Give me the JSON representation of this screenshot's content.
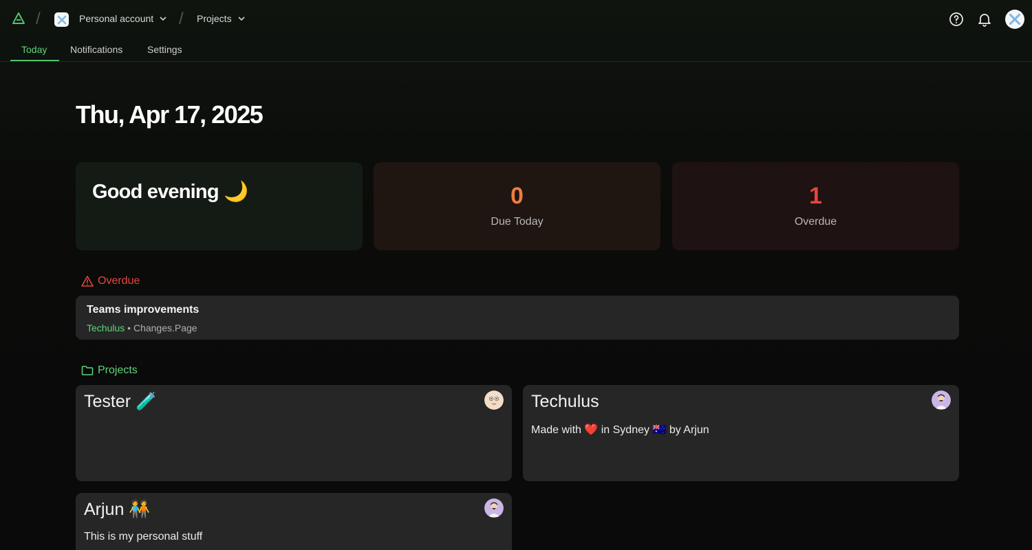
{
  "header": {
    "account": "Personal account",
    "projects_crumb": "Projects"
  },
  "tabs": [
    {
      "label": "Today",
      "active": true
    },
    {
      "label": "Notifications",
      "active": false
    },
    {
      "label": "Settings",
      "active": false
    }
  ],
  "date_title": "Thu, Apr 17, 2025",
  "greeting": "Good evening 🌙",
  "stats": [
    {
      "value": "0",
      "label": "Due Today",
      "color": "#ef7d3c"
    },
    {
      "value": "1",
      "label": "Overdue",
      "color": "#e4473f"
    }
  ],
  "overdue": {
    "heading": "Overdue",
    "items": [
      {
        "title": "Teams improvements",
        "project": "Techulus",
        "separator": " • ",
        "tag": "Changes.Page"
      }
    ]
  },
  "projects": {
    "heading": "Projects",
    "items": [
      {
        "title": "Tester 🧪",
        "description": ""
      },
      {
        "title": "Techulus",
        "description": "Made with ❤️ in Sydney 🇦🇺 by Arjun"
      },
      {
        "title": "Arjun 🧑‍🤝‍🧑",
        "description": "This is my personal stuff"
      }
    ]
  },
  "colors": {
    "accent_green": "#5ed67a",
    "warning_red": "#e4473f",
    "orange": "#ef7d3c"
  },
  "icons": [
    "app-logo-icon",
    "chevron-down-icon",
    "help-icon",
    "bell-icon",
    "warning-triangle-icon",
    "folder-icon"
  ]
}
